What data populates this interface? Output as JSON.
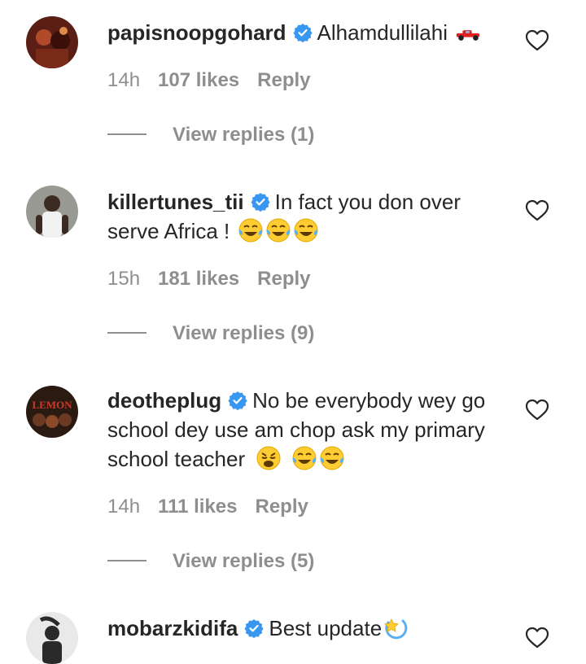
{
  "comments": [
    {
      "username": "papisnoopgohard",
      "text": "Alhamdullilahi",
      "emojis": [
        "racing-car"
      ],
      "time": "14h",
      "likes": "107 likes",
      "reply": "Reply",
      "view_replies": "View replies (1)"
    },
    {
      "username": "killertunes_tii",
      "text": "In fact you don over serve Africa !",
      "emojis": [
        "tears-of-joy",
        "tears-of-joy",
        "tears-of-joy"
      ],
      "time": "15h",
      "likes": "181 likes",
      "reply": "Reply",
      "view_replies": "View replies (9)"
    },
    {
      "username": "deotheplug",
      "text": "No be everybody wey go school dey use am chop ask my primary school teacher",
      "emojis": [
        "weary-face",
        "tears-of-joy",
        "tears-of-joy"
      ],
      "time": "14h",
      "likes": "111 likes",
      "reply": "Reply",
      "view_replies": "View replies (5)",
      "avatar_text": "LEMON"
    },
    {
      "username": "mobarzkidifa",
      "text": "Best update",
      "emojis": [
        "dizzy"
      ]
    }
  ],
  "colors": {
    "text": "#262626",
    "muted": "#8e8e8e",
    "verified": "#3897f0"
  }
}
